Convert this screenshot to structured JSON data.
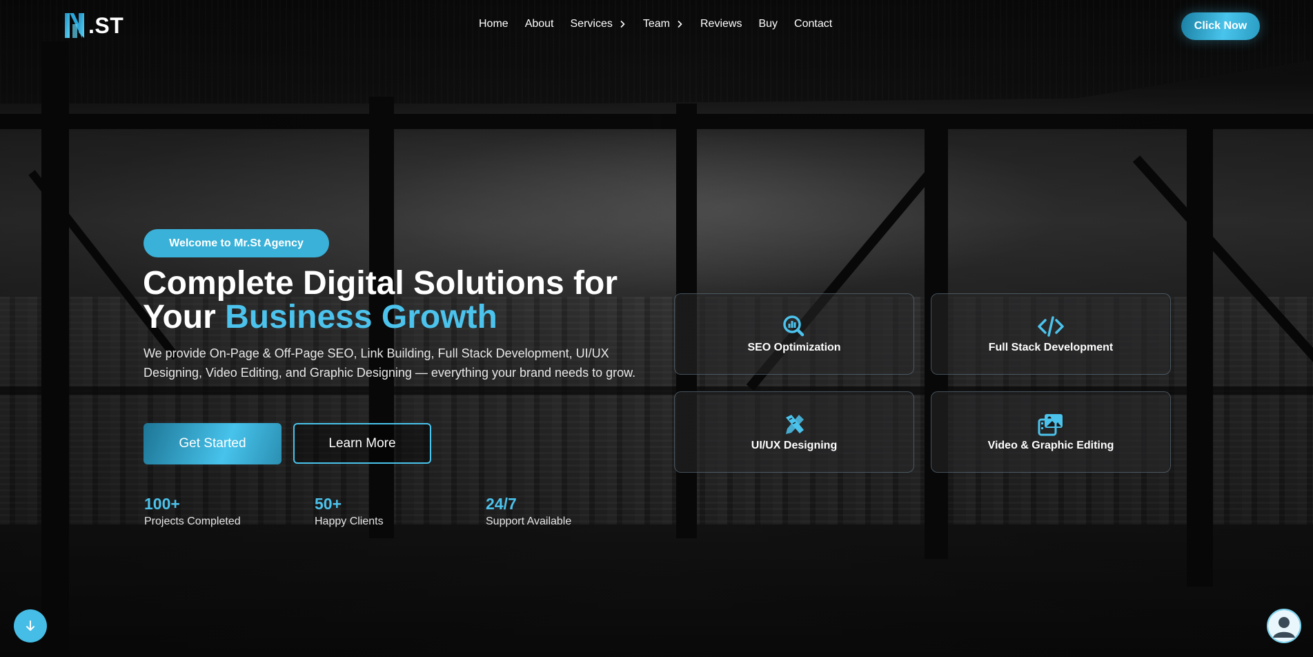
{
  "brand": {
    "logo_text": ".ST",
    "accent_color": "#4cc3ec",
    "logo_icon": "mst-logo-icon"
  },
  "nav": {
    "items": [
      {
        "label": "Home",
        "has_submenu": false
      },
      {
        "label": "About",
        "has_submenu": false
      },
      {
        "label": "Services",
        "has_submenu": true
      },
      {
        "label": "Team",
        "has_submenu": true
      },
      {
        "label": "Reviews",
        "has_submenu": false
      },
      {
        "label": "Buy",
        "has_submenu": false
      },
      {
        "label": "Contact",
        "has_submenu": false
      }
    ],
    "cta_label": "Click Now"
  },
  "hero": {
    "badge": "Welcome to Mr.St Agency",
    "title_line1": "Complete Digital Solutions for",
    "title_line2_prefix": "Your ",
    "title_line2_accent": "Business Growth",
    "description": "We provide On-Page & Off-Page SEO, Link Building, Full Stack Development, UI/UX Designing, Video Editing, and Graphic Designing — everything your brand needs to grow.",
    "primary_button": "Get Started",
    "secondary_button": "Learn More",
    "stats": [
      {
        "value": "100+",
        "label": "Projects Completed"
      },
      {
        "value": "50+",
        "label": "Happy Clients"
      },
      {
        "value": "24/7",
        "label": "Support Available"
      }
    ]
  },
  "services": [
    {
      "label": "SEO Optimization",
      "icon": "search-chart-icon"
    },
    {
      "label": "Full Stack Development",
      "icon": "code-icon"
    },
    {
      "label": "UI/UX Designing",
      "icon": "pencil-ruler-icon"
    },
    {
      "label": "Video & Graphic Editing",
      "icon": "photo-film-icon"
    }
  ],
  "floating": {
    "scroll_icon": "arrow-down-icon",
    "chat_icon": "user-avatar-icon"
  }
}
